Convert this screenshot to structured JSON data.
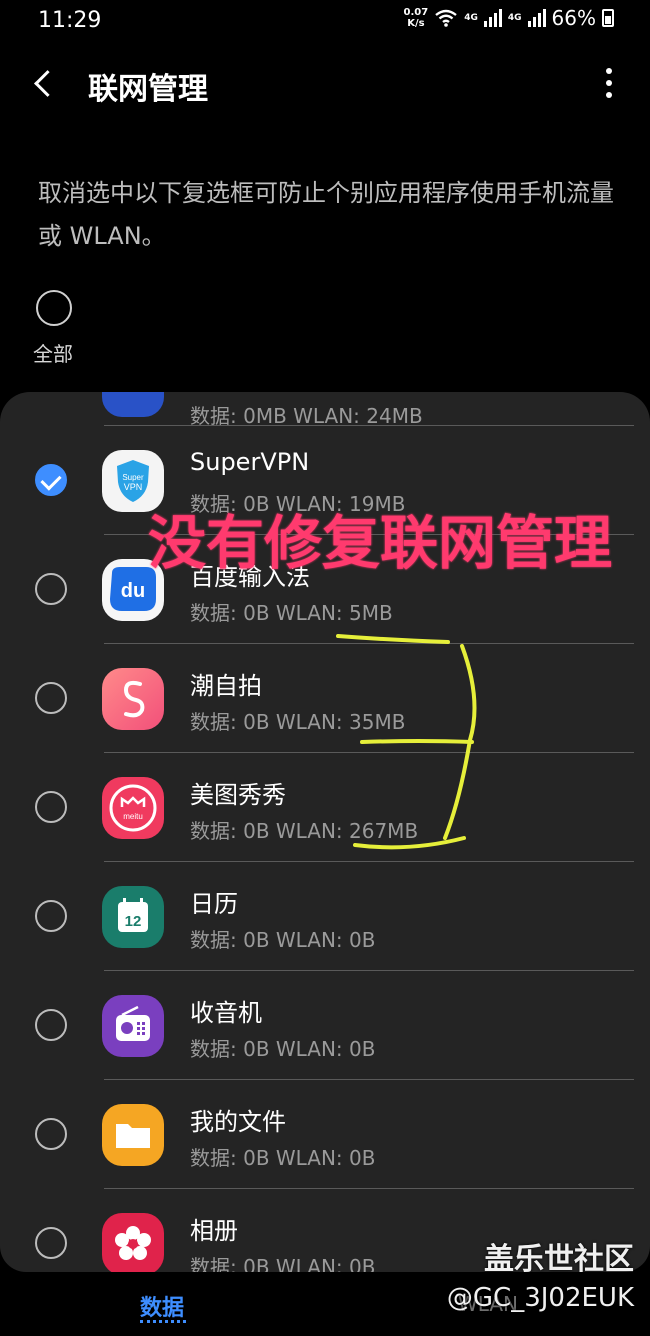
{
  "status_bar": {
    "time": "11:29",
    "net_speed_value": "0.07",
    "net_speed_unit": "K/s",
    "network_4g_1": "4G",
    "network_4g_2": "4G",
    "battery": "66%"
  },
  "header": {
    "title": "联网管理"
  },
  "description": "取消选中以下复选框可防止个别应用程序使用手机流量或 WLAN。",
  "all_toggle": {
    "label": "全部",
    "checked": false
  },
  "apps": [
    {
      "name": "",
      "usage": "数据: 0MB  WLAN: 24MB",
      "checked": false,
      "icon": "app-icon-partial"
    },
    {
      "name": "SuperVPN",
      "usage": "数据: 0B  WLAN: 19MB",
      "checked": true,
      "icon": "supervpn-icon",
      "icon_text": "Super VPN"
    },
    {
      "name": "百度输入法",
      "usage": "数据: 0B  WLAN: 5MB",
      "checked": false,
      "icon": "baidu-input-icon",
      "icon_text": "du"
    },
    {
      "name": "潮自拍",
      "usage": "数据: 0B  WLAN: 35MB",
      "checked": false,
      "icon": "chao-selfie-icon",
      "icon_text": "S"
    },
    {
      "name": "美图秀秀",
      "usage": "数据: 0B  WLAN: 267MB",
      "checked": false,
      "icon": "meitu-icon",
      "icon_text": "meitu"
    },
    {
      "name": "日历",
      "usage": "数据: 0B  WLAN: 0B",
      "checked": false,
      "icon": "calendar-icon",
      "icon_text": "12"
    },
    {
      "name": "收音机",
      "usage": "数据: 0B  WLAN: 0B",
      "checked": false,
      "icon": "radio-icon"
    },
    {
      "name": "我的文件",
      "usage": "数据: 0B  WLAN: 0B",
      "checked": false,
      "icon": "folder-icon"
    },
    {
      "name": "相册",
      "usage": "数据: 0B  WLAN: 0B",
      "checked": false,
      "icon": "gallery-icon"
    }
  ],
  "annotation": {
    "text": "没有修复联网管理",
    "text_color": "#ff3a6e",
    "marker_color": "#e6ef3a"
  },
  "bottom_tabs": {
    "data_label": "数据",
    "wlan_label": "WLAN"
  },
  "watermark": {
    "line1": "盖乐世社区",
    "line2": "@GC_3J02EUK"
  },
  "colors": {
    "accent": "#3e8eff",
    "card_bg": "#242424"
  }
}
